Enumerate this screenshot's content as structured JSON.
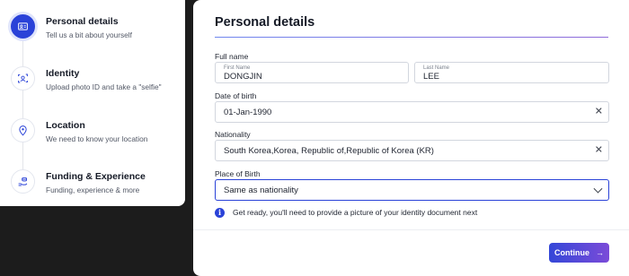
{
  "steps": [
    {
      "title": "Personal details",
      "desc": "Tell us a bit about yourself",
      "icon": "id-card-icon",
      "active": true
    },
    {
      "title": "Identity",
      "desc": "Upload photo ID and take a \"selfie\"",
      "icon": "face-scan-icon",
      "active": false
    },
    {
      "title": "Location",
      "desc": "We need to know your location",
      "icon": "location-pin-icon",
      "active": false
    },
    {
      "title": "Funding & Experience",
      "desc": "Funding, experience & more",
      "icon": "funding-icon",
      "active": false
    }
  ],
  "form": {
    "title": "Personal details",
    "full_name": {
      "label": "Full name",
      "first_label": "First Name",
      "first_value": "DONGJIN",
      "last_label": "Last Name",
      "last_value": "LEE"
    },
    "dob": {
      "label": "Date of birth",
      "value": "01-Jan-1990",
      "clear": "✕"
    },
    "nationality": {
      "label": "Nationality",
      "value": "South Korea,Korea, Republic of,Republic of Korea (KR)",
      "clear": "✕"
    },
    "place_of_birth": {
      "label": "Place of Birth",
      "value": "Same as nationality"
    },
    "info": {
      "icon": "i",
      "text": "Get ready, you'll need to provide a picture of your identity document next"
    },
    "continue": {
      "label": "Continue",
      "arrow": "→"
    }
  },
  "colors": {
    "accent": "#2a42d8",
    "accent_end": "#7b4bd8",
    "background": "#1c1c1c"
  }
}
